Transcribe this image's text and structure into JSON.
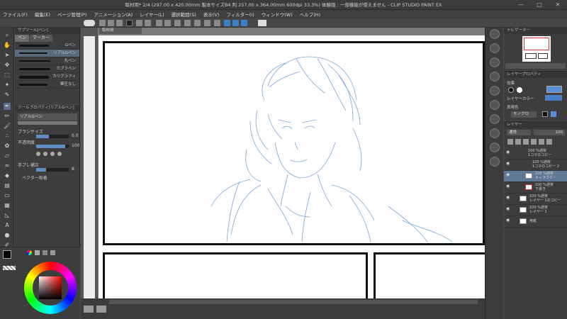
{
  "window": {
    "title": "取材用* 2/4 (297.00 x 420.00mm 製本サイズB4 判 257.00 x 364.00mm 600dpi 33.3%) 体験版 : 一部機能が使えません - CLIP STUDIO PAINT EX",
    "minimize": "—",
    "maximize": "□",
    "close": "✕"
  },
  "menu": [
    "ファイル(F)",
    "編集(E)",
    "ページ管理(P)",
    "アニメーション(A)",
    "レイヤー(L)",
    "選択範囲(S)",
    "表示(V)",
    "フィルター(I)",
    "ウィンドウ(W)",
    "ヘルプ(H)"
  ],
  "subtool": {
    "header": "サブツール[ペン]",
    "tabs": [
      "ペン",
      "マーカー"
    ],
    "brushes": [
      "Gペン",
      "リアルGペン",
      "丸ペン",
      "カブラペン",
      "カリグラフィ",
      "筆圧なし"
    ]
  },
  "toolprop": {
    "header": "ツールプロパティ[リアルGペン]",
    "brush_name": "リアルGペン",
    "size_label": "ブラシサイズ",
    "size_value": "6.0",
    "opacity_label": "不透明度",
    "opacity_value": "100",
    "stabilize_label": "手ブレ補正",
    "stabilize_value": "8",
    "vector_label": "ベクター吸着",
    "size_fill": 0.4,
    "opacity_fill": 0.9,
    "stabilize_fill": 0.3
  },
  "doc_tab": "取材用",
  "navigator": {
    "tab": "ナビゲーター"
  },
  "layerprop": {
    "header": "レイヤープロパティ",
    "effect_label": "効果",
    "layer_color_label": "レイヤーカラー",
    "expression_label": "表現色",
    "mono_label": "モノクロ"
  },
  "layers": {
    "tab": "レイヤー",
    "blend": "通常",
    "opacity": "100",
    "rows": [
      {
        "pct": "100 %通常",
        "name": "1コマのコピー"
      },
      {
        "pct": "100 %通常",
        "name": "1コマのコピー 2"
      },
      {
        "pct": "100 %通常",
        "name": "キャラクター"
      },
      {
        "pct": "100 %通常",
        "name": "下書き"
      },
      {
        "pct": "100 %通常",
        "name": "レイヤー 1のコピー"
      },
      {
        "pct": "100 %通常",
        "name": "レイヤー 1"
      },
      {
        "pct": "",
        "name": "用紙"
      }
    ]
  },
  "colors": {
    "accent": "#5d8fc2",
    "sketch": "#7aa7d8",
    "selection": "#5f7896",
    "main_color": "#000000",
    "sub_color": "#ffffff"
  }
}
